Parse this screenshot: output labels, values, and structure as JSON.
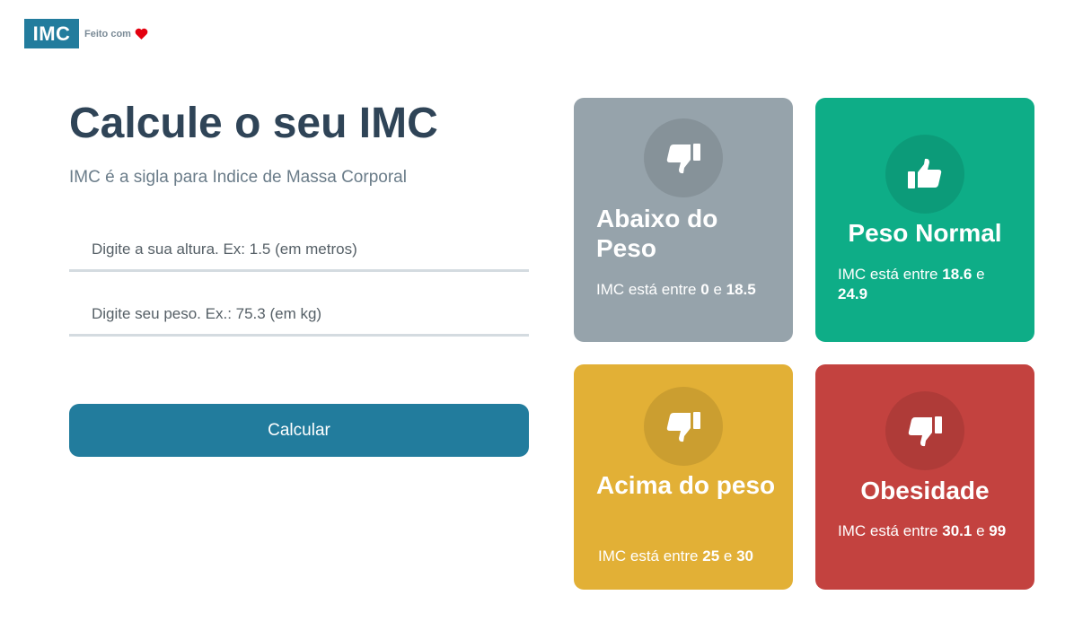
{
  "header": {
    "logo_text": "IMC",
    "made_with_text": "Feito com",
    "heart_icon": "heart-icon",
    "heart_color": "#e3000f"
  },
  "main": {
    "title": "Calcule o seu IMC",
    "subtitle": "IMC é a sigla para Indice de Massa Corporal",
    "height_input": {
      "value": "",
      "placeholder": "Digite a sua altura. Ex: 1.5 (em metros)"
    },
    "weight_input": {
      "value": "",
      "placeholder": "Digite seu peso. Ex.: 75.3 (em kg)"
    },
    "calculate_label": "Calcular",
    "accent_color": "#227c9d"
  },
  "cards": [
    {
      "title": "Abaixo do Peso",
      "desc_prefix": "IMC está entre",
      "min": "0",
      "sep": "e",
      "max": "18.5",
      "icon": "thumbs-down-icon",
      "color": "#96a3ab"
    },
    {
      "title": "Peso Normal",
      "desc_prefix": "IMC está entre",
      "min": "18.6",
      "sep": "e",
      "max": "24.9",
      "icon": "thumbs-up-icon",
      "color": "#0ead87"
    },
    {
      "title": "Acima do peso",
      "desc_prefix": "IMC está entre",
      "min": "25",
      "sep": "e",
      "max": "30",
      "icon": "thumbs-down-icon",
      "color": "#e2b036"
    },
    {
      "title": "Obesidade",
      "desc_prefix": "IMC está entre",
      "min": "30.1",
      "sep": "e",
      "max": "99",
      "icon": "thumbs-down-icon",
      "color": "#c3423f"
    }
  ]
}
